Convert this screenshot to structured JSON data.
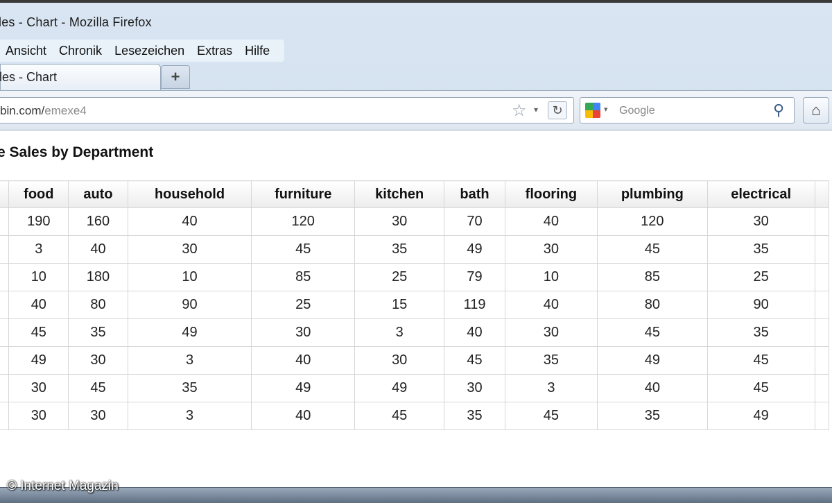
{
  "window": {
    "title": "les - Chart - Mozilla Firefox"
  },
  "menu": [
    "Ansicht",
    "Chronik",
    "Lesezeichen",
    "Extras",
    "Hilfe"
  ],
  "tab": {
    "label": "les - Chart",
    "new_tab": "+"
  },
  "nav": {
    "url_main": "bin.com/",
    "url_path": "emexe4",
    "search_placeholder": "Google"
  },
  "page": {
    "title": "e Sales by Department"
  },
  "table": {
    "headers": [
      "",
      "food",
      "auto",
      "household",
      "furniture",
      "kitchen",
      "bath",
      "flooring",
      "plumbing",
      "electrical",
      ""
    ],
    "rows": [
      [
        "",
        "190",
        "160",
        "40",
        "120",
        "30",
        "70",
        "40",
        "120",
        "30",
        ""
      ],
      [
        "",
        "3",
        "40",
        "30",
        "45",
        "35",
        "49",
        "30",
        "45",
        "35",
        ""
      ],
      [
        "",
        "10",
        "180",
        "10",
        "85",
        "25",
        "79",
        "10",
        "85",
        "25",
        ""
      ],
      [
        "",
        "40",
        "80",
        "90",
        "25",
        "15",
        "119",
        "40",
        "80",
        "90",
        ""
      ],
      [
        "",
        "45",
        "35",
        "49",
        "30",
        "3",
        "40",
        "30",
        "45",
        "35",
        ""
      ],
      [
        "",
        "49",
        "30",
        "3",
        "40",
        "30",
        "45",
        "35",
        "49",
        "45",
        ""
      ],
      [
        "",
        "30",
        "45",
        "35",
        "49",
        "49",
        "30",
        "3",
        "40",
        "45",
        ""
      ],
      [
        "",
        "30",
        "30",
        "3",
        "40",
        "45",
        "35",
        "45",
        "35",
        "49",
        ""
      ]
    ]
  },
  "watermark": "© Internet Magazin",
  "icons": {
    "star": "star-icon",
    "reload": "reload-icon",
    "search": "magnifier-icon",
    "home": "home-icon"
  }
}
